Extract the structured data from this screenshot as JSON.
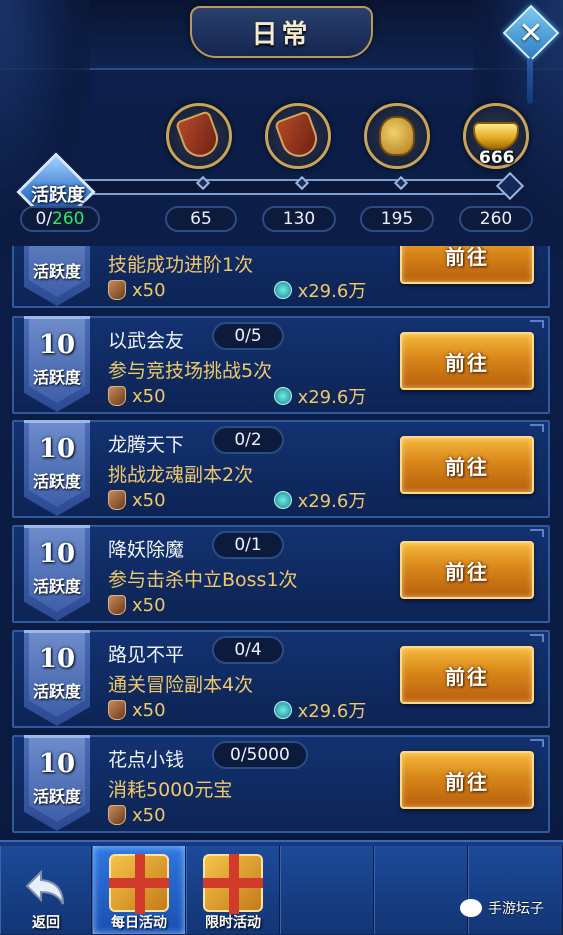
{
  "header": {
    "title": "日常"
  },
  "activity": {
    "label": "活跃度",
    "current": "0/",
    "max": "260",
    "progress_fraction": 0.0,
    "milestones": [
      "65",
      "130",
      "195",
      "260"
    ],
    "rewards": [
      {
        "icon": "shield-item-icon",
        "count": ""
      },
      {
        "icon": "shield-item-icon",
        "count": ""
      },
      {
        "icon": "treasure-bag-icon",
        "count": ""
      },
      {
        "icon": "gold-ingot-icon",
        "count": "666"
      }
    ]
  },
  "tasks": [
    {
      "points": "",
      "badge_label": "活跃度",
      "name": "",
      "progress": "",
      "desc": "技能成功进阶1次",
      "item_reward": "x50",
      "coin_reward": "x29.6万",
      "button": "前往"
    },
    {
      "points": "10",
      "badge_label": "活跃度",
      "name": "以武会友",
      "progress": "0/5",
      "desc": "参与竞技场挑战5次",
      "item_reward": "x50",
      "coin_reward": "x29.6万",
      "button": "前往"
    },
    {
      "points": "10",
      "badge_label": "活跃度",
      "name": "龙腾天下",
      "progress": "0/2",
      "desc": "挑战龙魂副本2次",
      "item_reward": "x50",
      "coin_reward": "x29.6万",
      "button": "前往"
    },
    {
      "points": "10",
      "badge_label": "活跃度",
      "name": "降妖除魔",
      "progress": "0/1",
      "desc": "参与击杀中立Boss1次",
      "item_reward": "x50",
      "coin_reward": "",
      "button": "前往"
    },
    {
      "points": "10",
      "badge_label": "活跃度",
      "name": "路见不平",
      "progress": "0/4",
      "desc": "通关冒险副本4次",
      "item_reward": "x50",
      "coin_reward": "x29.6万",
      "button": "前往"
    },
    {
      "points": "10",
      "badge_label": "活跃度",
      "name": "花点小钱",
      "progress": "0/5000",
      "desc": "消耗5000元宝",
      "item_reward": "x50",
      "coin_reward": "",
      "button": "前往"
    }
  ],
  "nav": {
    "back": "返回",
    "daily": "每日活动",
    "limited": "限时活动"
  },
  "watermark": "手游坛子",
  "colors": {
    "accent_green": "#2ee85e",
    "gold_text": "#f0c86a",
    "button_orange": "#d8861a"
  }
}
